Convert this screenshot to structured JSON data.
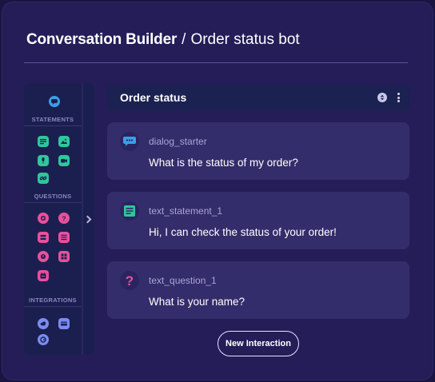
{
  "header": {
    "title": "Conversation Builder",
    "separator": "/",
    "subtitle": "Order status bot"
  },
  "toolbox": {
    "sections": [
      {
        "label": "STATEMENTS"
      },
      {
        "label": "QUESTIONS"
      },
      {
        "label": "INTEGRATIONS"
      }
    ],
    "colors": {
      "statement_accent": "#2fc79b",
      "question_accent": "#e8509b",
      "integration_accent": "#7a8cf0",
      "chat_accent": "#3aa0e6"
    }
  },
  "panel": {
    "title": "Order status",
    "icons": [
      "sort-icon",
      "kebab-menu-icon"
    ]
  },
  "interactions": [
    {
      "id": "dialog_starter",
      "text": "What is the status of my order?",
      "icon": "chat-bubble-icon"
    },
    {
      "id": "text_statement_1",
      "text": "Hi, I can check the status of your order!",
      "icon": "text-lines-icon"
    },
    {
      "id": "text_question_1",
      "text": "What is your name?",
      "icon": "question-mark-icon"
    }
  ],
  "actions": {
    "new_interaction": "New Interaction"
  }
}
